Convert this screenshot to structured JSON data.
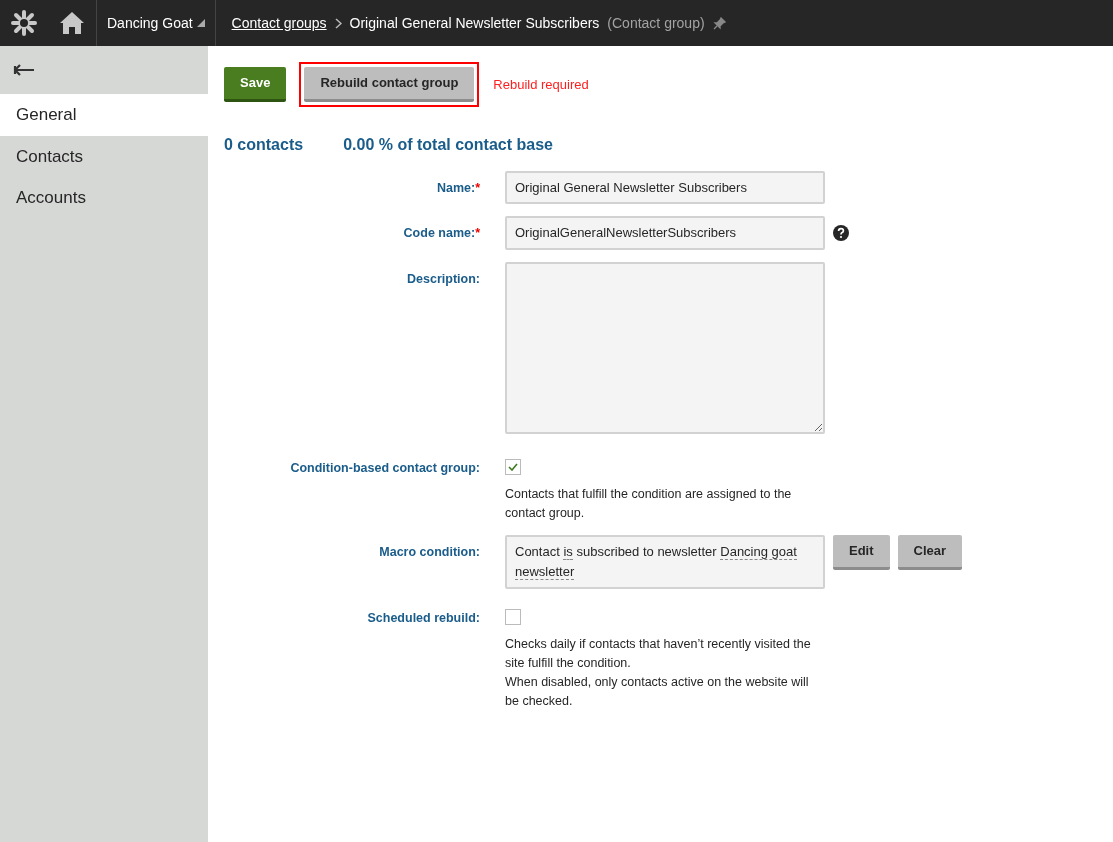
{
  "header": {
    "site": "Dancing Goat",
    "breadcrumb": [
      {
        "text": "Contact groups",
        "kind": "link"
      },
      {
        "text": "Original General Newsletter Subscribers",
        "kind": "current"
      }
    ],
    "object_type": "(Contact group)"
  },
  "sidebar": {
    "items": [
      {
        "label": "General",
        "selected": true
      },
      {
        "label": "Contacts",
        "selected": false
      },
      {
        "label": "Accounts",
        "selected": false
      }
    ]
  },
  "toolbar": {
    "buttons": [
      {
        "label": "Save",
        "kind": "primary",
        "highlighted": false
      },
      {
        "label": "Rebuild contact group",
        "kind": "secondary",
        "highlighted": true
      }
    ],
    "warning": "Rebuild required"
  },
  "stats": [
    "0 contacts",
    "0.00 % of total contact base"
  ],
  "fields": [
    {
      "kind": "text",
      "label": "Name:",
      "required_mark": "*",
      "value": "Original General Newsletter Subscribers",
      "help": false
    },
    {
      "kind": "text",
      "label": "Code name:",
      "required_mark": "*",
      "value": "OriginalGeneralNewsletterSubscribers",
      "help": true
    },
    {
      "kind": "textarea",
      "label": "Description:"
    },
    {
      "kind": "checkbox",
      "label": "Condition-based contact group:",
      "checked": true,
      "notes": [
        "Contacts that fulfill the condition are assigned to the contact group."
      ]
    },
    {
      "kind": "macro",
      "label": "Macro condition:",
      "parts": [
        {
          "text": "Contact",
          "term": false
        },
        {
          "text": "is",
          "term": true
        },
        {
          "text": "subscribed to newsletter",
          "term": false
        },
        {
          "text": "Dancing goat newsletter",
          "term": true
        }
      ],
      "buttons": [
        "Edit",
        "Clear"
      ]
    },
    {
      "kind": "checkbox",
      "label": "Scheduled rebuild:",
      "checked": false,
      "notes": [
        "Checks daily if contacts that haven’t recently visited the site fulfill the condition.",
        "When disabled, only contacts active on the website will be checked."
      ]
    }
  ]
}
